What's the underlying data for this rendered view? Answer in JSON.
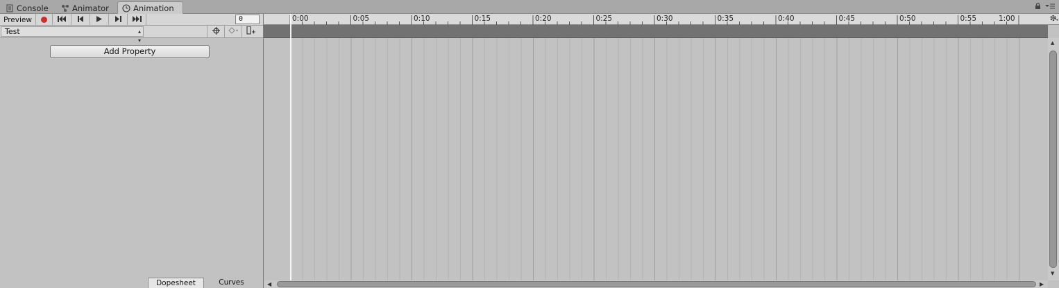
{
  "tabs": [
    {
      "label": "Console",
      "icon": "console-icon"
    },
    {
      "label": "Animator",
      "icon": "animator-icon"
    },
    {
      "label": "Animation",
      "icon": "clock-icon",
      "active": true
    }
  ],
  "toolbar": {
    "preview_label": "Preview",
    "record_color": "#d32a2a",
    "frame_value": "0"
  },
  "clip": {
    "selected": "Test"
  },
  "add_property_label": "Add Property",
  "bottom_tabs": [
    {
      "label": "Dopesheet",
      "active": true
    },
    {
      "label": "Curves",
      "active": false
    }
  ],
  "timeline": {
    "labels": [
      "0:00",
      "0:05",
      "0:10",
      "0:15",
      "0:20",
      "0:25",
      "0:30",
      "0:35",
      "0:40",
      "0:45",
      "0:50",
      "0:55",
      "1:00"
    ]
  },
  "colors": {
    "background": "#c2c2c2",
    "summary_bar": "#727272",
    "playhead": "#ffffff"
  }
}
